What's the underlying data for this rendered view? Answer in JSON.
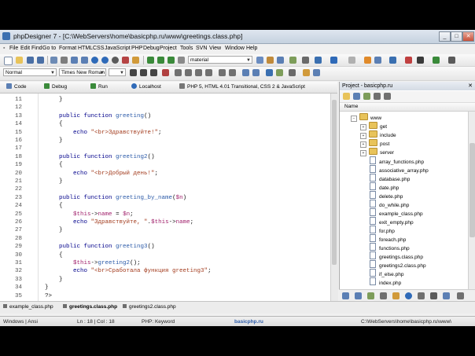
{
  "window": {
    "app_name": "phpDesigner 7",
    "title": "phpDesigner 7 - [C:\\WebServers\\home\\basicphp.ru\\www\\greetings.class.php]",
    "controls": [
      "_",
      "□",
      "✕"
    ]
  },
  "menu": [
    "File",
    "Edit",
    "Find",
    "Go to",
    "Format",
    "HTML",
    "CSS",
    "JavaScript",
    "PHP",
    "Debug",
    "Project",
    "Tools",
    "SVN",
    "View",
    "Window",
    "Help"
  ],
  "toolbar2": {
    "style_combo": "Normal",
    "font_combo": "Times New Roman",
    "theme_combo": "material"
  },
  "editor_toolbar": {
    "code_tab": "Code",
    "debug": "Debug",
    "run": "Run",
    "localhost": "Localhost",
    "syntax": "PHP 5, HTML 4.01 Transitional, CSS 2 & JavaScript"
  },
  "code_lines": [
    {
      "n": "11",
      "indent": "    ",
      "parts": [
        [
          "plain",
          "}"
        ]
      ]
    },
    {
      "n": "12",
      "indent": "",
      "parts": []
    },
    {
      "n": "13",
      "indent": "    ",
      "parts": [
        [
          "kw",
          "public "
        ],
        [
          "kw",
          "function "
        ],
        [
          "fn",
          "greeting"
        ],
        [
          "plain",
          "()"
        ]
      ]
    },
    {
      "n": "14",
      "indent": "    ",
      "parts": [
        [
          "plain",
          "{"
        ]
      ]
    },
    {
      "n": "15",
      "indent": "        ",
      "parts": [
        [
          "kw",
          "echo "
        ],
        [
          "str",
          "\"<br>Здравствуйте!\""
        ],
        [
          "plain",
          ";"
        ]
      ]
    },
    {
      "n": "16",
      "indent": "    ",
      "parts": [
        [
          "plain",
          "}"
        ]
      ]
    },
    {
      "n": "17",
      "indent": "",
      "parts": []
    },
    {
      "n": "18",
      "indent": "    ",
      "parts": [
        [
          "kw",
          "public "
        ],
        [
          "kw",
          "function "
        ],
        [
          "fn",
          "greeting2"
        ],
        [
          "plain",
          "()"
        ]
      ]
    },
    {
      "n": "19",
      "indent": "    ",
      "parts": [
        [
          "plain",
          "{"
        ]
      ]
    },
    {
      "n": "20",
      "indent": "        ",
      "parts": [
        [
          "kw",
          "echo "
        ],
        [
          "str",
          "\"<br>Добрый день!\""
        ],
        [
          "plain",
          ";"
        ]
      ]
    },
    {
      "n": "21",
      "indent": "    ",
      "parts": [
        [
          "plain",
          "}"
        ]
      ]
    },
    {
      "n": "22",
      "indent": "",
      "parts": []
    },
    {
      "n": "23",
      "indent": "    ",
      "parts": [
        [
          "kw",
          "public "
        ],
        [
          "kw",
          "function "
        ],
        [
          "fn",
          "greeting_by_name"
        ],
        [
          "plain",
          "("
        ],
        [
          "var",
          "$n"
        ],
        [
          "plain",
          ")"
        ]
      ]
    },
    {
      "n": "24",
      "indent": "    ",
      "parts": [
        [
          "plain",
          "{"
        ]
      ]
    },
    {
      "n": "25",
      "indent": "        ",
      "parts": [
        [
          "var",
          "$this"
        ],
        [
          "plain",
          "->"
        ],
        [
          "var",
          "name"
        ],
        [
          "plain",
          " = "
        ],
        [
          "var",
          "$n"
        ],
        [
          "plain",
          ";"
        ]
      ]
    },
    {
      "n": "26",
      "indent": "        ",
      "parts": [
        [
          "kw",
          "echo "
        ],
        [
          "str",
          "\"Здравствуйте, \""
        ],
        [
          "plain",
          "."
        ],
        [
          "var",
          "$this"
        ],
        [
          "plain",
          "->"
        ],
        [
          "var",
          "name"
        ],
        [
          "plain",
          ";"
        ]
      ]
    },
    {
      "n": "27",
      "indent": "    ",
      "parts": [
        [
          "plain",
          "}"
        ]
      ]
    },
    {
      "n": "28",
      "indent": "",
      "parts": []
    },
    {
      "n": "29",
      "indent": "    ",
      "parts": [
        [
          "kw",
          "public "
        ],
        [
          "kw",
          "function "
        ],
        [
          "fn",
          "greeting3"
        ],
        [
          "plain",
          "()"
        ]
      ]
    },
    {
      "n": "30",
      "indent": "    ",
      "parts": [
        [
          "plain",
          "{"
        ]
      ]
    },
    {
      "n": "31",
      "indent": "        ",
      "parts": [
        [
          "var",
          "$this"
        ],
        [
          "plain",
          "->"
        ],
        [
          "fn",
          "greeting2"
        ],
        [
          "plain",
          "();"
        ]
      ]
    },
    {
      "n": "32",
      "indent": "        ",
      "parts": [
        [
          "kw",
          "echo "
        ],
        [
          "str",
          "\"<br>Сработала функция greeting3\""
        ],
        [
          "plain",
          ";"
        ]
      ]
    },
    {
      "n": "33",
      "indent": "    ",
      "parts": [
        [
          "plain",
          "}"
        ]
      ]
    },
    {
      "n": "34",
      "indent": "",
      "parts": [
        [
          "plain",
          "}"
        ]
      ]
    },
    {
      "n": "35",
      "indent": "",
      "parts": [
        [
          "plain",
          "?>"
        ]
      ]
    }
  ],
  "project": {
    "title": "Project - basicphp.ru",
    "column": "Name",
    "root": "www",
    "folders": [
      "get",
      "include",
      "post",
      "server"
    ],
    "files": [
      "array_functions.php",
      "associative_array.php",
      "database.php",
      "date.php",
      "delete.php",
      "do_while.php",
      "example_class.php",
      "exit_empty.php",
      "for.php",
      "foreach.php",
      "functions.php",
      "greetings.class.php",
      "greetings2.class.php",
      "if_else.php",
      "index.php"
    ]
  },
  "open_tabs": [
    "example_class.php",
    "greetings.class.php",
    "greetings2.class.php"
  ],
  "status": {
    "encoding": "Windows | Ansi",
    "position": "Ln : 18 | Col : 18",
    "context": "PHP: Keyword",
    "project": "basicphp.ru",
    "path": "C:\\WebServers\\home\\basicphp.ru\\www\\"
  },
  "colors": {
    "keyword": "#00008b",
    "function": "#2b5aa8",
    "string": "#a33c1e",
    "variable": "#a0206b",
    "status_project": "#2b5aa8"
  }
}
